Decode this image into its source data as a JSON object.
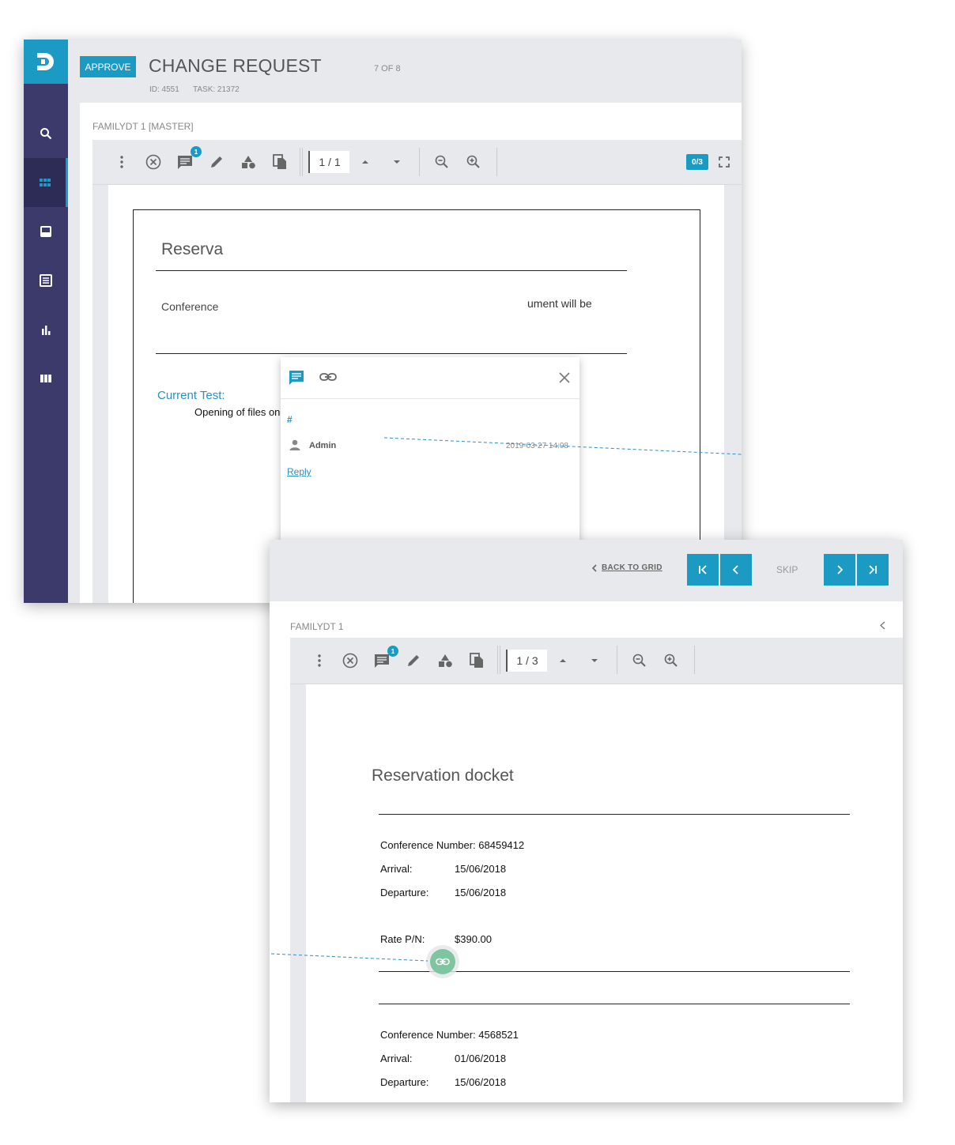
{
  "window1": {
    "approve_label": "APPROVE",
    "title": "CHANGE REQUEST",
    "position": "7 OF 8",
    "id": "ID: 4551",
    "task": "TASK: 21372",
    "document_label": "FAMILYDT 1 [MASTER]",
    "toolbar": {
      "comment_badge": "1",
      "page": "1 / 1",
      "annotation_count": "0/3"
    },
    "sidebar": {
      "items": [
        {
          "icon": "search-icon"
        },
        {
          "icon": "grid-icon",
          "active": true
        },
        {
          "icon": "inbox-icon"
        },
        {
          "icon": "list-icon"
        },
        {
          "icon": "bar-chart-icon"
        },
        {
          "icon": "columns-icon"
        }
      ]
    },
    "document": {
      "title": "Reserva",
      "conference_label": "Conference",
      "tail_text": "ument will be",
      "current_test_label": "Current Test:",
      "current_test_value": "Opening of files on the cloud."
    },
    "comment_popup": {
      "hash": "#",
      "user": "Admin",
      "date": "2019-03-27 14:08",
      "reply_label": "Reply"
    }
  },
  "window2": {
    "back_label": "BACK TO GRID",
    "skip_label": "SKIP",
    "document_label": "FAMILYDT 1",
    "toolbar": {
      "comment_badge": "1",
      "page": "1 / 3"
    },
    "document": {
      "title": "Reservation docket",
      "block1": {
        "conference": "Conference Number: 68459412",
        "arrival_label": "Arrival:",
        "arrival_value": "15/06/2018",
        "departure_label": "Departure:",
        "departure_value": "15/06/2018",
        "rate_label": "Rate P/N:",
        "rate_value": "$390.00"
      },
      "block2": {
        "conference": "Conference Number: 4568521",
        "arrival_label": "Arrival:",
        "arrival_value": "01/06/2018",
        "departure_label": "Departure:",
        "departure_value": "15/06/2018"
      }
    }
  },
  "colors": {
    "accent": "#1b9ac4",
    "sidebar": "#3b3a6a",
    "link_marker": "#7fc6a0",
    "toolbar_bg": "#e8e9ec"
  }
}
